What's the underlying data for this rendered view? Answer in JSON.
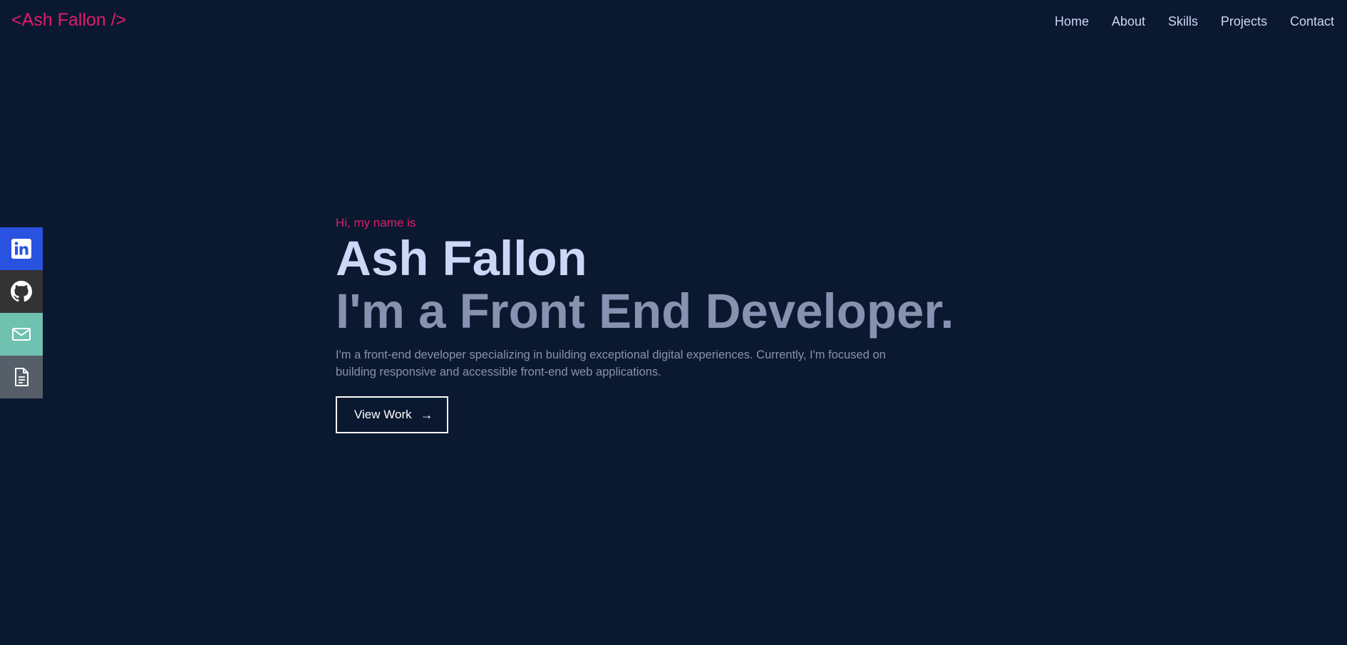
{
  "brand": {
    "logo_text": "<Ash Fallon />"
  },
  "nav": {
    "items": [
      {
        "label": "Home"
      },
      {
        "label": "About"
      },
      {
        "label": "Skills"
      },
      {
        "label": "Projects"
      },
      {
        "label": "Contact"
      }
    ]
  },
  "social": {
    "items": [
      {
        "icon": "linkedin-icon",
        "color": "#2a52e0"
      },
      {
        "icon": "github-icon",
        "color": "#333333"
      },
      {
        "icon": "mail-icon",
        "color": "#6fc2b0"
      },
      {
        "icon": "resume-document-icon",
        "color": "#565f69"
      }
    ]
  },
  "hero": {
    "greeting": "Hi, my name is",
    "name": "Ash Fallon",
    "role": "I'm a Front End Developer.",
    "intro": "I'm a front-end developer specializing in building exceptional digital experiences. Currently, I'm focused on building responsive and accessible front-end web applications.",
    "cta_label": "View Work",
    "cta_arrow": "→"
  },
  "colors": {
    "background": "#0a192f",
    "accent": "#e31b6d",
    "heading": "#ccd6f6",
    "muted": "#8892b0"
  }
}
